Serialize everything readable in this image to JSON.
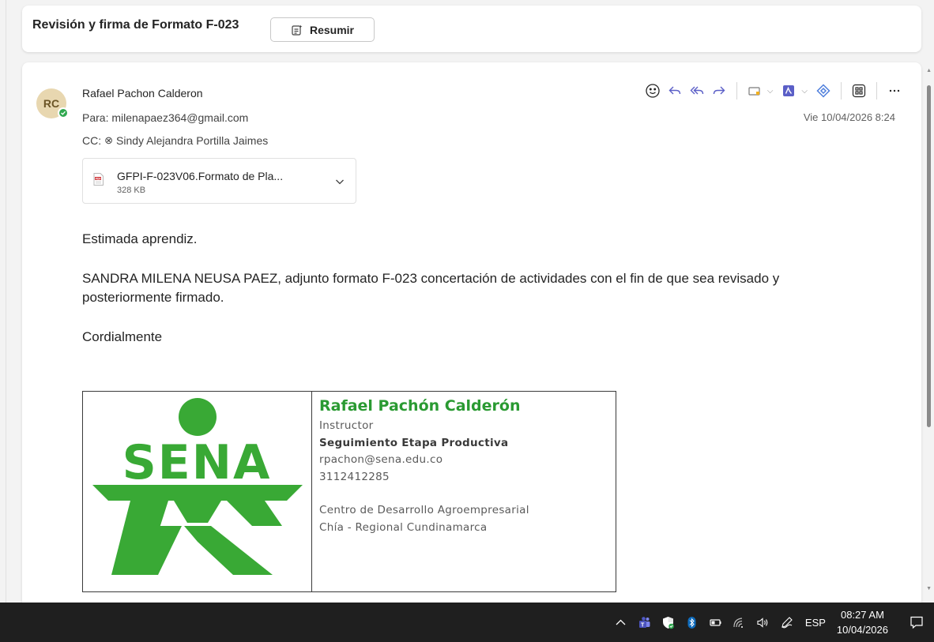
{
  "subject": {
    "title": "Revisión y firma de Formato F-023",
    "summarize_label": "Resumir"
  },
  "message": {
    "avatar_initials": "RC",
    "sender": "Rafael Pachon Calderon",
    "to": "Para: milenapaez364@gmail.com",
    "cc_label": "CC:",
    "cc_name": "Sindy Alejandra Portilla Jaimes",
    "datetime": "Vie 10/04/2026 8:24",
    "attachment": {
      "name": "GFPI-F-023V06.Formato de Pla...",
      "size": "328 KB"
    },
    "body": {
      "greeting": "Estimada aprendiz.",
      "paragraph": "SANDRA MILENA NEUSA PAEZ, adjunto formato F-023 concertación de actividades con el fin de que sea revisado y posteriormente firmado.",
      "closing": "Cordialmente"
    },
    "signature": {
      "logo_text": "SENA",
      "name": "Rafael Pachón Calderón",
      "role": "Instructor",
      "area": "Seguimiento Etapa Productiva",
      "email": "rpachon@sena.edu.co",
      "phone": "3112412285",
      "center": "Centro de Desarrollo Agroempresarial",
      "region": "Chía - Regional Cundinamarca"
    }
  },
  "toolbar_icons": [
    "emoji-icon",
    "reply-icon",
    "reply-all-icon",
    "forward-icon",
    "tag-icon",
    "pdf-app-icon",
    "loop-icon",
    "apps-icon",
    "more-icon"
  ],
  "taskbar": {
    "language": "ESP",
    "time": "08:27 AM",
    "date": "10/04/2026"
  },
  "colors": {
    "sena_green": "#39a935",
    "presence_green": "#2fa84f",
    "accent_blue": "#0f6cbd"
  }
}
